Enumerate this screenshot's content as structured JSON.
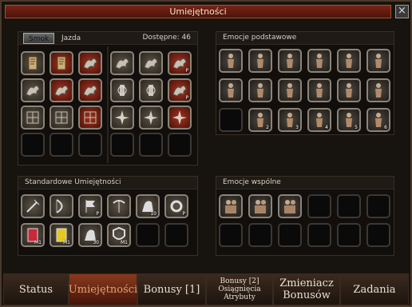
{
  "window": {
    "title": "Umiejętności",
    "close_label": "×"
  },
  "skills_panel": {
    "tabs": [
      "Smok",
      "Jazda"
    ],
    "active_tab": "Smok",
    "available_label": "Dostępne: 46"
  },
  "emotions_basic": {
    "title": "Emocje podstawowe",
    "row3_labels": [
      "2",
      "3",
      "4",
      "5",
      "6"
    ]
  },
  "standard_skills": {
    "title": "Standardowe Umiejętności",
    "row1_labels": [
      "",
      "",
      "P",
      "",
      "10",
      "P"
    ],
    "row2_labels": [
      "M1",
      "M1",
      "30",
      "M1"
    ]
  },
  "emotions_shared": {
    "title": "Emocje wspólne"
  },
  "bottom_tabs": [
    {
      "label": "Status"
    },
    {
      "label": "Umiejętności"
    },
    {
      "label": "Bonusy [1]"
    },
    {
      "line1": "Bonusy [2]",
      "line2": "Osiągnięcia",
      "line3": "Atrybuty"
    },
    {
      "line1": "Zmieniacz",
      "line2": "Bonusów"
    },
    {
      "label": "Zadania"
    }
  ],
  "active_bottom_tab": "Umiejętności",
  "colors": {
    "title_bar": "#7a2416",
    "active_tab": "#8a3a1c",
    "panel_bg": "#110e0b"
  }
}
